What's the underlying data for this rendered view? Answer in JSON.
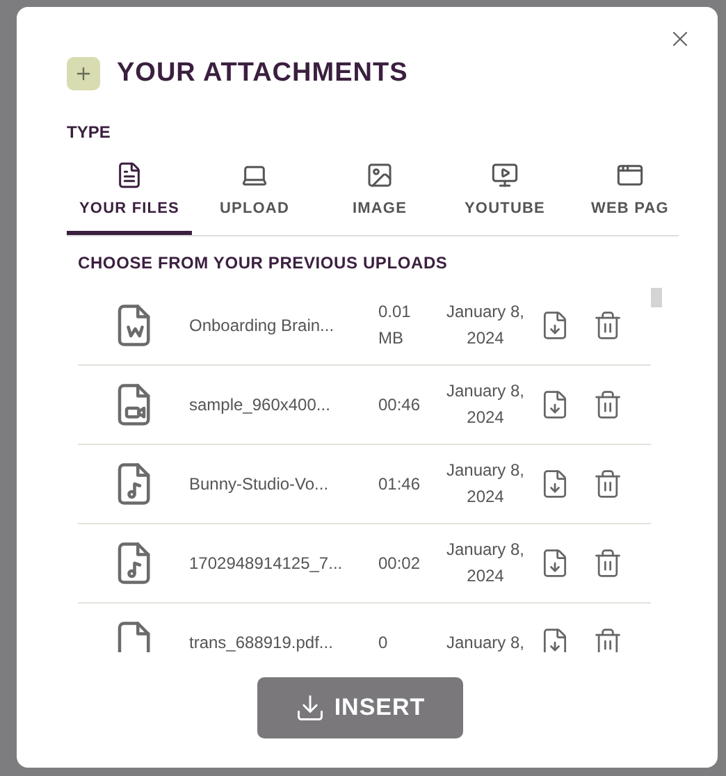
{
  "dialog": {
    "title": "YOUR ATTACHMENTS",
    "type_label": "TYPE",
    "tabs": [
      {
        "label": "YOUR FILES",
        "kind": "files",
        "selected": true
      },
      {
        "label": "UPLOAD",
        "kind": "upload",
        "selected": false
      },
      {
        "label": "IMAGE",
        "kind": "image",
        "selected": false
      },
      {
        "label": "YOUTUBE",
        "kind": "youtube",
        "selected": false
      },
      {
        "label": "WEB PAG",
        "kind": "web",
        "selected": false
      }
    ],
    "section_title": "CHOOSE FROM YOUR PREVIOUS UPLOADS",
    "files": [
      {
        "kind": "word",
        "name": "Onboarding Brain...",
        "size": "0.01 MB",
        "date": "January 8, 2024"
      },
      {
        "kind": "video",
        "name": "sample_960x400...",
        "size": "00:46",
        "date": "January 8, 2024"
      },
      {
        "kind": "audio",
        "name": "Bunny-Studio-Vo...",
        "size": "01:46",
        "date": "January 8, 2024"
      },
      {
        "kind": "audio",
        "name": "1702948914125_7...",
        "size": "00:02",
        "date": "January 8, 2024"
      },
      {
        "kind": "pdf",
        "name": "trans_688919.pdf...",
        "size": "0",
        "date": "January 8,"
      }
    ],
    "insert_button": "INSERT"
  }
}
